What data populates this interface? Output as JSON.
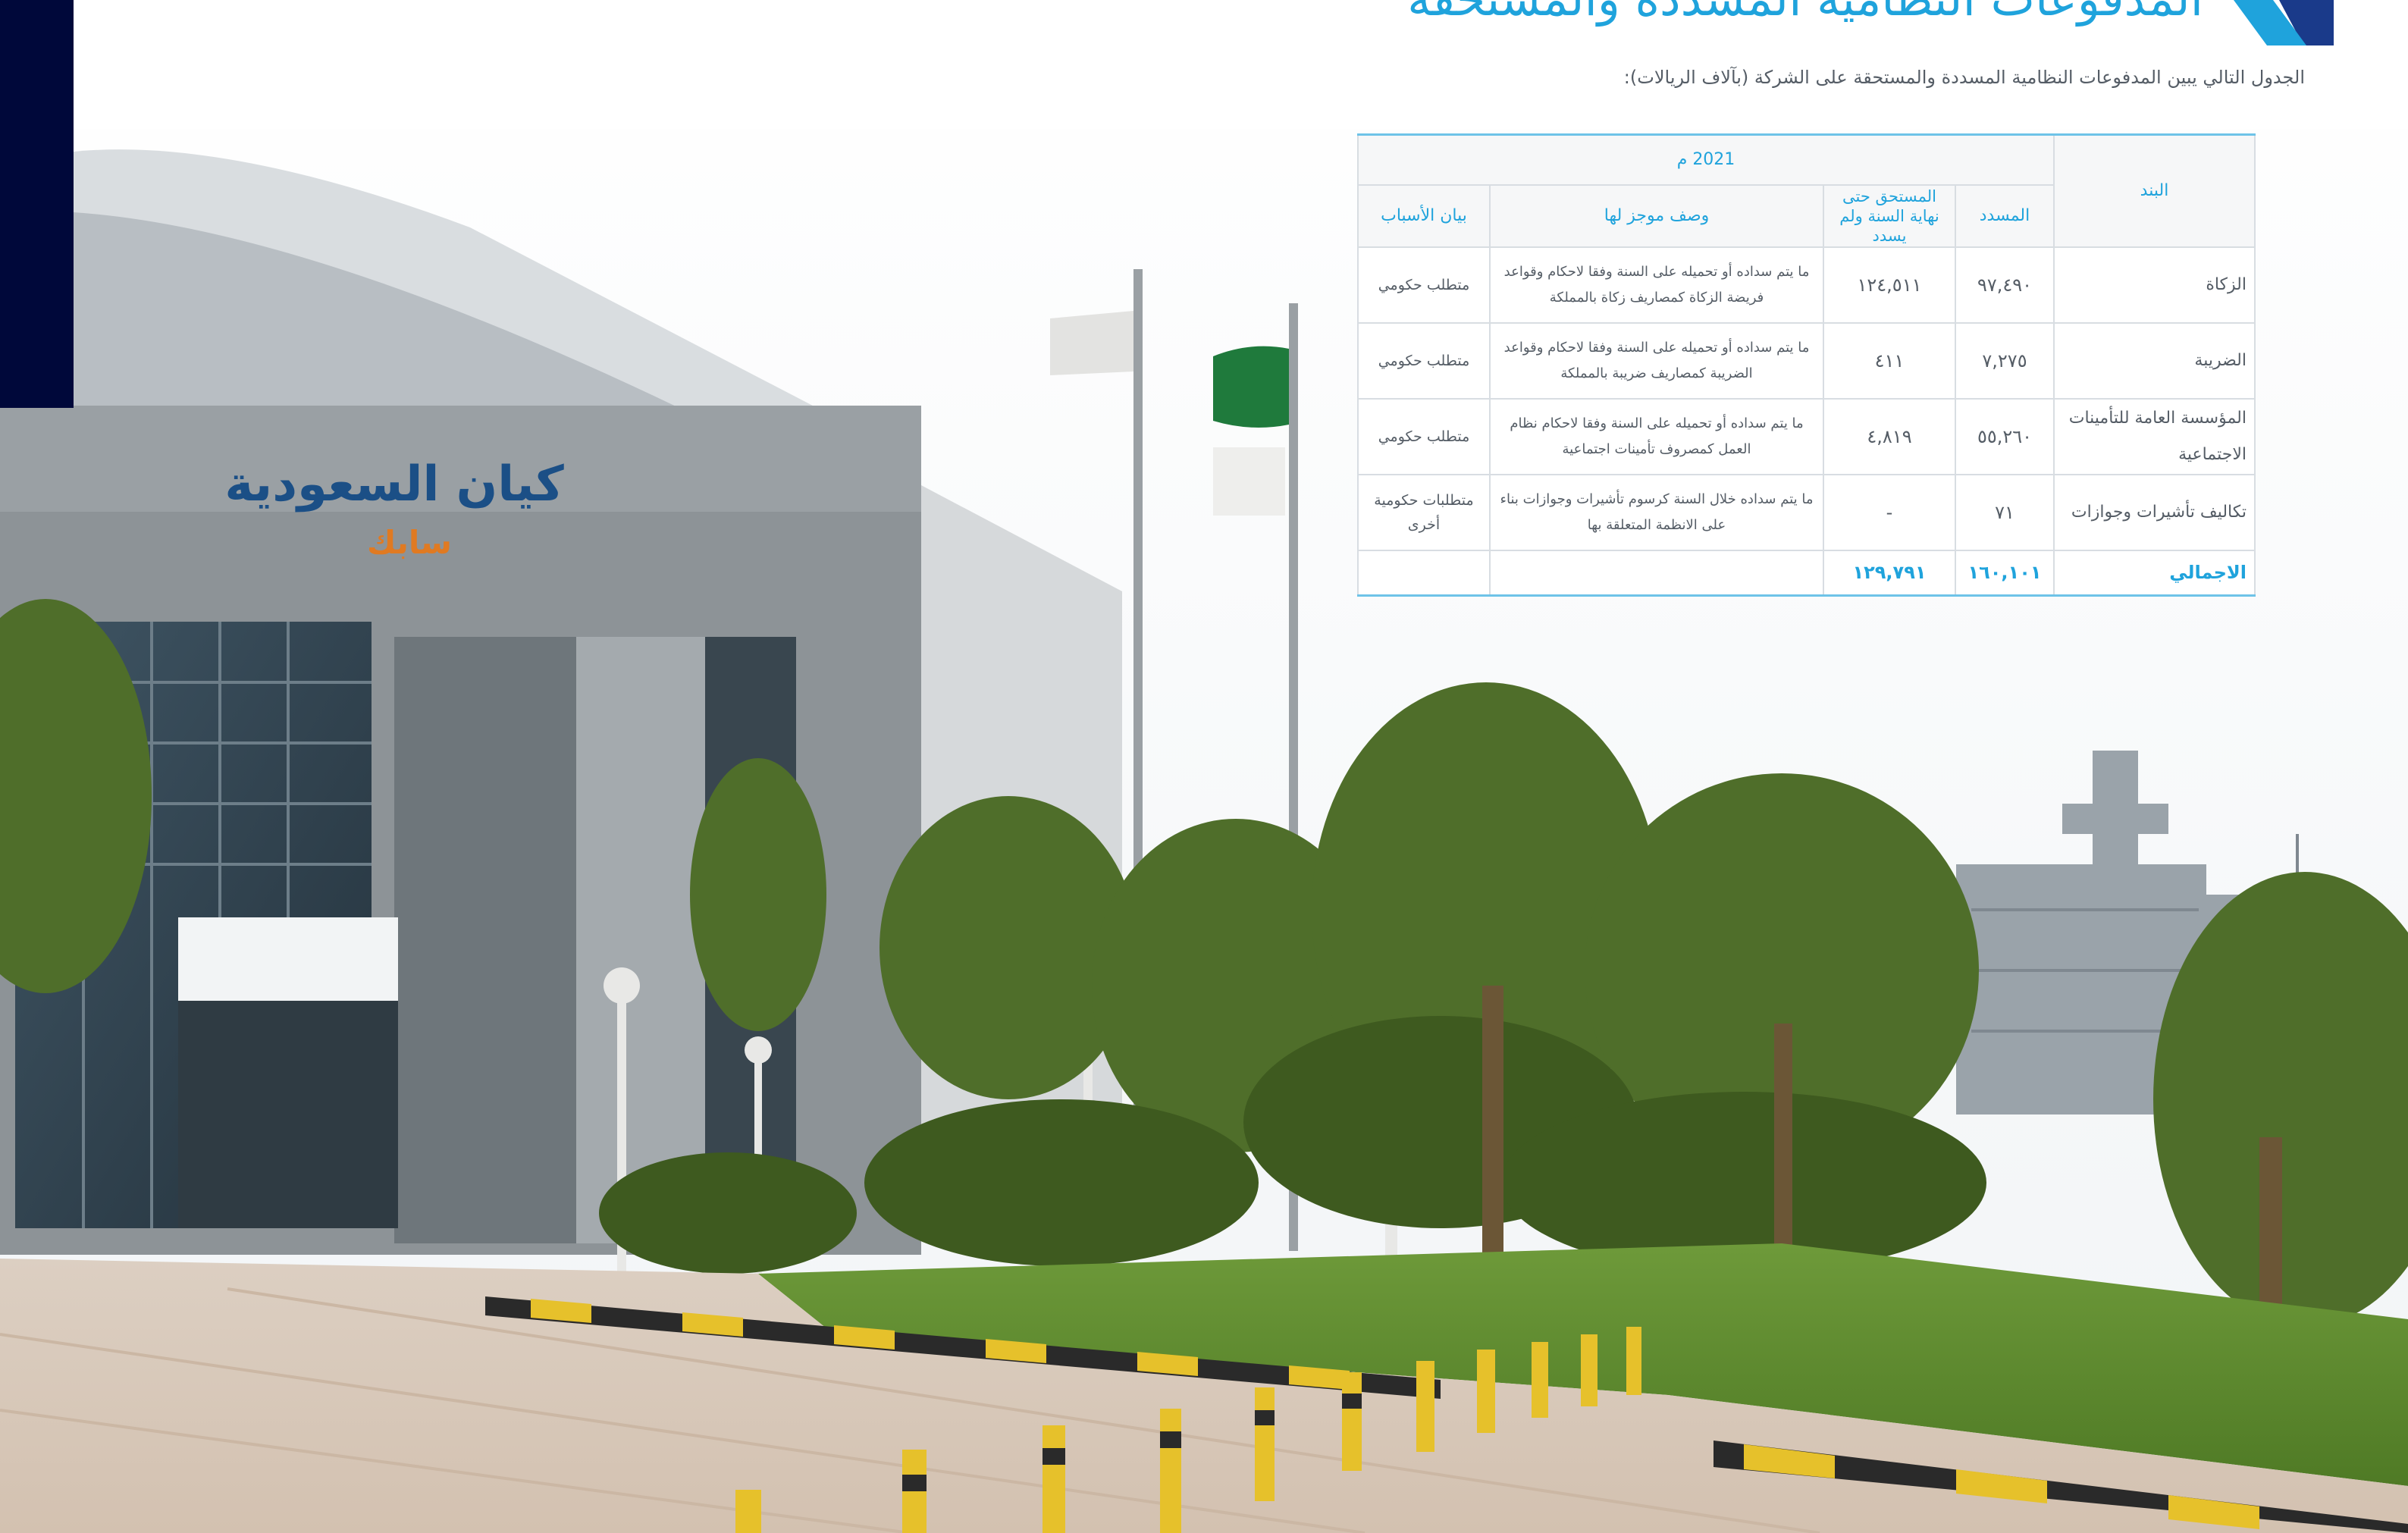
{
  "heading": "المدفوعات النظامية المسددة والمستحقة",
  "intro": "الجدول التالي يبين المدفوعات النظامية المسددة والمستحقة على الشركة (بآلاف الريالات):",
  "table": {
    "headers": {
      "item": "البند",
      "year": "2021 م",
      "paid": "المسدد",
      "due": "المستحق حتى نهاية السنة ولم يسدد",
      "description": "وصف موجز لها",
      "reasons": "بيان الأسباب"
    },
    "rows": [
      {
        "item": "الزكاة",
        "paid": "٩٧,٤٩٠",
        "due": "١٢٤,٥١١",
        "description": "ما يتم سداده أو تحميله على السنة وفقا لاحكام وقواعد فريضة الزكاة كمصاريف زكاة بالمملكة",
        "reason": "متطلب حكومي"
      },
      {
        "item": "الضريبة",
        "paid": "٧,٢٧٥",
        "due": "٤١١",
        "description": "ما يتم سداده أو تحميله على السنة وفقا لاحكام وقواعد الضريبة كمصاريف ضريبة بالمملكة",
        "reason": "متطلب حكومي"
      },
      {
        "item": "المؤسسة العامة للتأمينات الاجتماعية",
        "paid": "٥٥,٢٦٠",
        "due": "٤,٨١٩",
        "description": "ما يتم سداده أو تحميله على السنة وفقا لاحكام نظام العمل كمصروف تأمينات اجتماعية",
        "reason": "متطلب حكومي"
      },
      {
        "item": "تكاليف تأشيرات وجوازات",
        "paid": "٧١",
        "due": "-",
        "description": "ما يتم سداده خلال السنة كرسوم تأشيرات وجوازات بناء على الانظمة المتعلقة بها",
        "reason": "متطلبات حكومية أخرى"
      }
    ],
    "total": {
      "label": "الاجمالي",
      "paid": "١٦٠,١٠١",
      "due": "١٢٩,٧٩١"
    }
  },
  "photo": {
    "sign_line1": "كيان السعودية",
    "sign_line2": "سابك"
  },
  "colors": {
    "accent": "#1fa3dc",
    "navy": "#00083a",
    "text": "#555d66"
  }
}
